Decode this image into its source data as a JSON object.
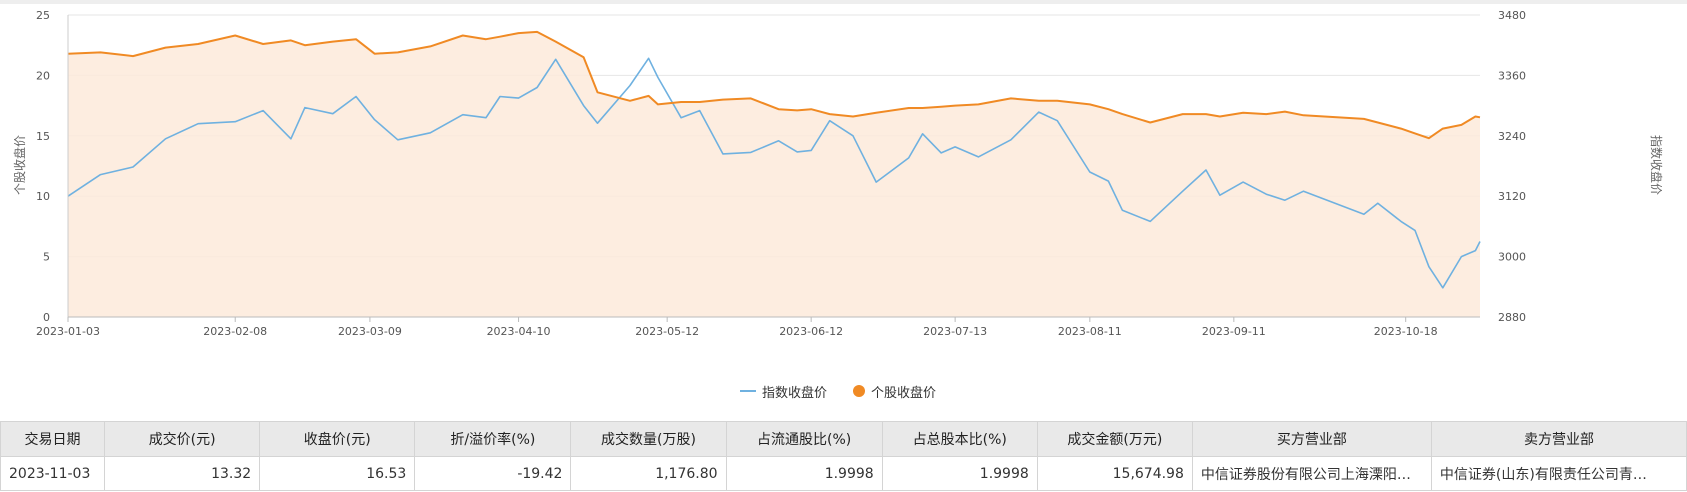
{
  "chart_data": {
    "type": "line",
    "x_tick_labels": [
      "2023-01-03",
      "2023-02-08",
      "2023-03-09",
      "2023-04-10",
      "2023-05-12",
      "2023-06-12",
      "2023-07-13",
      "2023-08-11",
      "2023-09-11",
      "2023-10-18"
    ],
    "ylabel_left": "个股收盘价",
    "ylabel_right": "指数收盘价",
    "ylim_left": [
      0,
      25
    ],
    "yticks_left": [
      0,
      5,
      10,
      15,
      20,
      25
    ],
    "ylim_right": [
      2880,
      3480
    ],
    "yticks_right": [
      2880,
      3000,
      3120,
      3240,
      3360,
      3480
    ],
    "grid": true,
    "legend_position": "bottom-center",
    "series": [
      {
        "name": "指数收盘价",
        "axis": "right",
        "color": "#6fb1e0",
        "style": "line",
        "points": [
          [
            "2023-01-03",
            3120
          ],
          [
            "2023-01-10",
            3163
          ],
          [
            "2023-01-17",
            3178
          ],
          [
            "2023-01-24",
            3234
          ],
          [
            "2023-01-31",
            3264
          ],
          [
            "2023-02-08",
            3268
          ],
          [
            "2023-02-14",
            3290
          ],
          [
            "2023-02-20",
            3234
          ],
          [
            "2023-02-23",
            3296
          ],
          [
            "2023-03-01",
            3284
          ],
          [
            "2023-03-06",
            3318
          ],
          [
            "2023-03-10",
            3272
          ],
          [
            "2023-03-15",
            3232
          ],
          [
            "2023-03-22",
            3246
          ],
          [
            "2023-03-29",
            3282
          ],
          [
            "2023-04-03",
            3276
          ],
          [
            "2023-04-06",
            3318
          ],
          [
            "2023-04-10",
            3315
          ],
          [
            "2023-04-14",
            3336
          ],
          [
            "2023-04-18",
            3392
          ],
          [
            "2023-04-24",
            3300
          ],
          [
            "2023-04-27",
            3265
          ],
          [
            "2023-05-04",
            3340
          ],
          [
            "2023-05-08",
            3394
          ],
          [
            "2023-05-10",
            3356
          ],
          [
            "2023-05-15",
            3276
          ],
          [
            "2023-05-19",
            3290
          ],
          [
            "2023-05-24",
            3204
          ],
          [
            "2023-05-30",
            3207
          ],
          [
            "2023-06-05",
            3230
          ],
          [
            "2023-06-09",
            3208
          ],
          [
            "2023-06-12",
            3211
          ],
          [
            "2023-06-16",
            3270
          ],
          [
            "2023-06-21",
            3240
          ],
          [
            "2023-06-26",
            3148
          ],
          [
            "2023-07-03",
            3196
          ],
          [
            "2023-07-06",
            3244
          ],
          [
            "2023-07-10",
            3206
          ],
          [
            "2023-07-13",
            3218
          ],
          [
            "2023-07-18",
            3198
          ],
          [
            "2023-07-25",
            3232
          ],
          [
            "2023-07-31",
            3287
          ],
          [
            "2023-08-04",
            3270
          ],
          [
            "2023-08-11",
            3168
          ],
          [
            "2023-08-15",
            3150
          ],
          [
            "2023-08-18",
            3092
          ],
          [
            "2023-08-24",
            3070
          ],
          [
            "2023-08-31",
            3130
          ],
          [
            "2023-09-05",
            3172
          ],
          [
            "2023-09-08",
            3122
          ],
          [
            "2023-09-13",
            3148
          ],
          [
            "2023-09-18",
            3124
          ],
          [
            "2023-09-22",
            3112
          ],
          [
            "2023-09-26",
            3130
          ],
          [
            "2023-10-09",
            3084
          ],
          [
            "2023-10-12",
            3106
          ],
          [
            "2023-10-17",
            3070
          ],
          [
            "2023-10-20",
            3052
          ],
          [
            "2023-10-23",
            2980
          ],
          [
            "2023-10-26",
            2938
          ],
          [
            "2023-10-30",
            3000
          ],
          [
            "2023-11-02",
            3012
          ],
          [
            "2023-11-03",
            3030
          ]
        ]
      },
      {
        "name": "个股收盘价",
        "axis": "left",
        "color": "#f08a24",
        "style": "area",
        "points": [
          [
            "2023-01-03",
            21.8
          ],
          [
            "2023-01-10",
            21.9
          ],
          [
            "2023-01-17",
            21.6
          ],
          [
            "2023-01-24",
            22.3
          ],
          [
            "2023-01-31",
            22.6
          ],
          [
            "2023-02-08",
            23.3
          ],
          [
            "2023-02-14",
            22.6
          ],
          [
            "2023-02-20",
            22.9
          ],
          [
            "2023-02-23",
            22.5
          ],
          [
            "2023-03-01",
            22.8
          ],
          [
            "2023-03-06",
            23.0
          ],
          [
            "2023-03-10",
            21.8
          ],
          [
            "2023-03-15",
            21.9
          ],
          [
            "2023-03-22",
            22.4
          ],
          [
            "2023-03-29",
            23.3
          ],
          [
            "2023-04-03",
            23.0
          ],
          [
            "2023-04-06",
            23.2
          ],
          [
            "2023-04-10",
            23.5
          ],
          [
            "2023-04-14",
            23.6
          ],
          [
            "2023-04-18",
            22.8
          ],
          [
            "2023-04-24",
            21.5
          ],
          [
            "2023-04-27",
            18.6
          ],
          [
            "2023-05-04",
            17.9
          ],
          [
            "2023-05-08",
            18.3
          ],
          [
            "2023-05-10",
            17.6
          ],
          [
            "2023-05-15",
            17.8
          ],
          [
            "2023-05-19",
            17.8
          ],
          [
            "2023-05-24",
            18.0
          ],
          [
            "2023-05-30",
            18.1
          ],
          [
            "2023-06-05",
            17.2
          ],
          [
            "2023-06-09",
            17.1
          ],
          [
            "2023-06-12",
            17.2
          ],
          [
            "2023-06-16",
            16.8
          ],
          [
            "2023-06-21",
            16.6
          ],
          [
            "2023-06-26",
            16.9
          ],
          [
            "2023-07-03",
            17.3
          ],
          [
            "2023-07-06",
            17.3
          ],
          [
            "2023-07-10",
            17.4
          ],
          [
            "2023-07-13",
            17.5
          ],
          [
            "2023-07-18",
            17.6
          ],
          [
            "2023-07-25",
            18.1
          ],
          [
            "2023-07-31",
            17.9
          ],
          [
            "2023-08-04",
            17.9
          ],
          [
            "2023-08-11",
            17.6
          ],
          [
            "2023-08-15",
            17.2
          ],
          [
            "2023-08-18",
            16.8
          ],
          [
            "2023-08-24",
            16.1
          ],
          [
            "2023-08-31",
            16.8
          ],
          [
            "2023-09-05",
            16.8
          ],
          [
            "2023-09-08",
            16.6
          ],
          [
            "2023-09-13",
            16.9
          ],
          [
            "2023-09-18",
            16.8
          ],
          [
            "2023-09-22",
            17.0
          ],
          [
            "2023-09-26",
            16.7
          ],
          [
            "2023-10-09",
            16.4
          ],
          [
            "2023-10-12",
            16.1
          ],
          [
            "2023-10-17",
            15.6
          ],
          [
            "2023-10-20",
            15.2
          ],
          [
            "2023-10-23",
            14.8
          ],
          [
            "2023-10-26",
            15.6
          ],
          [
            "2023-10-30",
            15.9
          ],
          [
            "2023-11-02",
            16.6
          ],
          [
            "2023-11-03",
            16.53
          ]
        ]
      }
    ]
  },
  "table": {
    "columns": [
      "交易日期",
      "成交价(元)",
      "收盘价(元)",
      "折/溢价率(%)",
      "成交数量(万股)",
      "占流通股比(%)",
      "占总股本比(%)",
      "成交金额(万元)",
      "买方营业部",
      "卖方营业部"
    ],
    "rows": [
      [
        "2023-11-03",
        "13.32",
        "16.53",
        "-19.42",
        "1,176.80",
        "1.9998",
        "1.9998",
        "15,674.98",
        "中信证券股份有限公司上海溧阳…",
        "中信证券(山东)有限责任公司青…"
      ]
    ]
  }
}
